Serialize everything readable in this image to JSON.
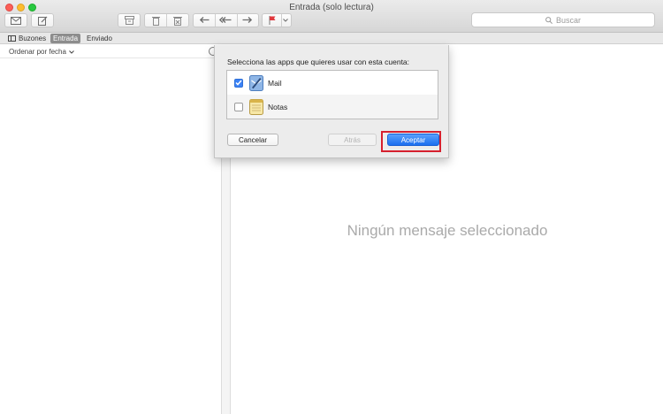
{
  "window": {
    "title": "Entrada (solo lectura)"
  },
  "toolbar": {
    "icons": [
      "envelope-icon",
      "compose-icon",
      "archive-icon",
      "trash-icon",
      "junk-icon",
      "reply-icon",
      "reply-all-icon",
      "forward-icon",
      "flag-icon",
      "chevron-down-icon"
    ],
    "search_placeholder": "Buscar",
    "flag_color": "#e0393e"
  },
  "favorites": {
    "mailboxes": "Buzones",
    "inbox": "Entrada",
    "sent": "Enviado"
  },
  "list": {
    "sort_label": "Ordenar por fecha"
  },
  "viewer": {
    "empty_message": "Ningún mensaje seleccionado"
  },
  "dialog": {
    "title": "Selecciona las apps que quieres usar con esta cuenta:",
    "apps": [
      {
        "label": "Mail",
        "checked": true,
        "icon": "mail-app-icon"
      },
      {
        "label": "Notas",
        "checked": false,
        "icon": "notes-app-icon"
      }
    ],
    "cancel_label": "Cancelar",
    "back_label": "Atrás",
    "accept_label": "Aceptar",
    "accent_color": "#1b6ff0",
    "highlight_color": "#d6202e"
  }
}
